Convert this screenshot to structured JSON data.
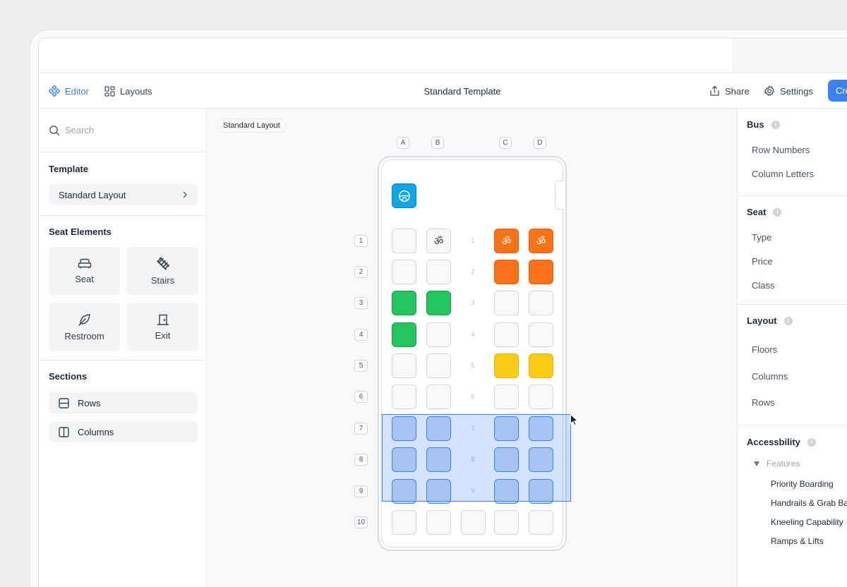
{
  "toolbar": {
    "editor_label": "Editor",
    "layouts_label": "Layouts",
    "title": "Standard Template",
    "share_label": "Share",
    "settings_label": "Settings",
    "create_label": "Cre"
  },
  "left": {
    "search_placeholder": "Search",
    "template_title": "Template",
    "template_value": "Standard Layout",
    "seat_elements_title": "Seat Elements",
    "elements": [
      "Seat",
      "Stairs",
      "Restroom",
      "Exit"
    ],
    "sections_title": "Sections",
    "sections": [
      "Rows",
      "Columns"
    ]
  },
  "canvas": {
    "chip": "Standard Layout",
    "columns": [
      "A",
      "B",
      "C",
      "D"
    ],
    "rows": [
      "1",
      "2",
      "3",
      "4",
      "5",
      "6",
      "7",
      "8",
      "9",
      "10"
    ],
    "aisle_numbers": [
      "1",
      "2",
      "3",
      "4",
      "5",
      "6",
      "7",
      "8",
      "9"
    ],
    "seat_symbol_accessible": "♿",
    "seat_symbol_om": "ॐ",
    "colors": {
      "green": "#22c55e",
      "orange": "#f97316",
      "yellow": "#facc15",
      "driver": "#0ea5e9",
      "selection": "#3b82f6"
    }
  },
  "right": {
    "bus_title": "Bus",
    "bus_items": [
      "Row  Numbers",
      "Column Letters"
    ],
    "seat_title": "Seat",
    "seat_items": [
      "Type",
      "Price",
      "Class"
    ],
    "layout_title": "Layout",
    "layout_items": [
      "Floors",
      "Columns",
      "Rows"
    ],
    "accessibility_title": "Accessbility",
    "features_label": "Features",
    "features": [
      "Priority Boarding",
      "Handrails & Grab Ba",
      "Kneeling Capability",
      "Ramps & Lifts"
    ],
    "info_glyph": "i"
  }
}
